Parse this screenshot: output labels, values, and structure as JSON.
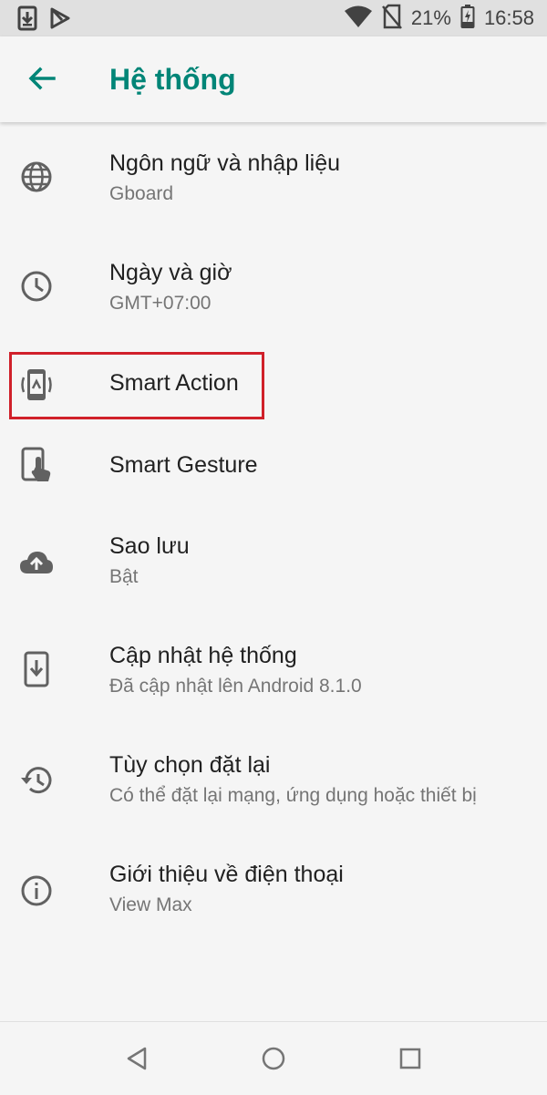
{
  "status_bar": {
    "battery_percent": "21%",
    "time": "16:58",
    "icons": [
      "download-icon",
      "play-store-icon",
      "wifi-icon",
      "no-sim-icon",
      "battery-charging-icon"
    ]
  },
  "app_bar": {
    "title": "Hệ thống",
    "accent_color": "#008577"
  },
  "items": [
    {
      "title": "Ngôn ngữ và nhập liệu",
      "subtitle": "Gboard",
      "icon": "globe-icon"
    },
    {
      "title": "Ngày và giờ",
      "subtitle": "GMT+07:00",
      "icon": "clock-icon"
    },
    {
      "title": "Smart Action",
      "icon": "smart-action-icon",
      "highlighted": true
    },
    {
      "title": "Smart Gesture",
      "icon": "smart-gesture-icon"
    },
    {
      "title": "Sao lưu",
      "subtitle": "Bật",
      "icon": "cloud-upload-icon"
    },
    {
      "title": "Cập nhật hệ thống",
      "subtitle": "Đã cập nhật lên Android 8.1.0",
      "icon": "system-update-icon"
    },
    {
      "title": "Tùy chọn đặt lại",
      "subtitle": "Có thể đặt lại mạng, ứng dụng hoặc thiết bị",
      "icon": "restore-icon"
    },
    {
      "title": "Giới thiệu về điện thoại",
      "subtitle": "View Max",
      "icon": "info-icon"
    }
  ],
  "nav_bar": {
    "buttons": [
      "back-triangle-icon",
      "home-circle-icon",
      "recents-square-icon"
    ]
  },
  "colors": {
    "highlight_border": "#d0202a",
    "icon_gray": "#616161",
    "text_primary": "#212121",
    "text_secondary": "#757575"
  }
}
